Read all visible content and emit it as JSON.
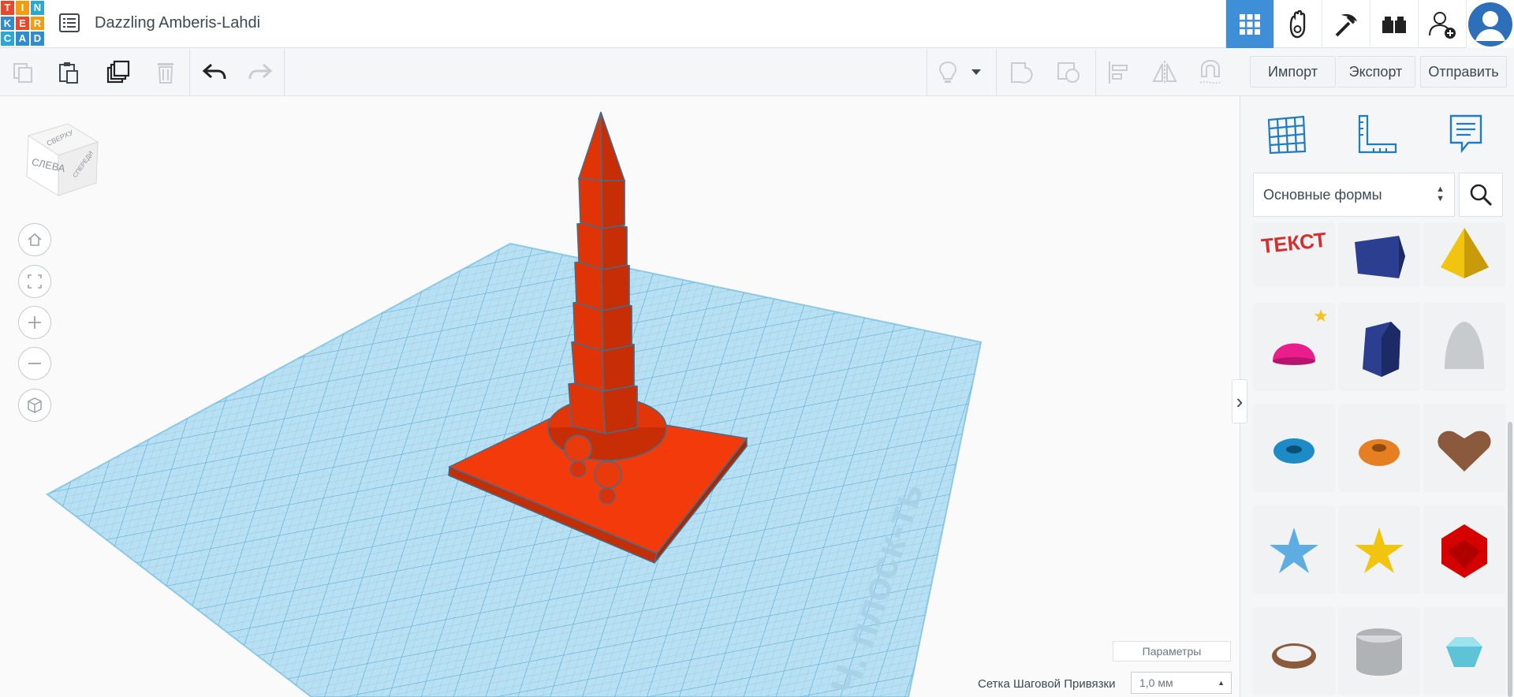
{
  "header": {
    "logo_letters": [
      "T",
      "I",
      "N",
      "K",
      "E",
      "R",
      "C",
      "A",
      "D"
    ],
    "logo_colors": [
      "#e8472b",
      "#f39c12",
      "#2aa7d4",
      "#2e8ccf",
      "#e8472b",
      "#f39c12",
      "#2aa7d4",
      "#2e8ccf",
      "#2e8ccf"
    ],
    "title": "Dazzling Amberis-Lahdi",
    "right_buttons": [
      "grid-view-icon",
      "tinker-hand-icon",
      "pickaxe-icon",
      "bricks-icon",
      "add-user-icon",
      "avatar"
    ]
  },
  "toolbar": {
    "left_tools": [
      "copy-icon",
      "paste-icon",
      "duplicate-icon",
      "delete-icon",
      "undo-icon",
      "redo-icon"
    ],
    "right_tools": [
      "lightbulb-icon",
      "dropdown-arrow-icon",
      "group-icon",
      "hole-icon",
      "align-icon",
      "mirror-icon",
      "magnet-icon"
    ]
  },
  "actions": {
    "import": "Импорт",
    "export": "Экспорт",
    "send": "Отправить"
  },
  "viewcube": {
    "top": "СВЕРХУ",
    "left": "СЛЕВА",
    "front": "СПЕРЕДИ"
  },
  "workplane": {
    "label": "Ч. плоск-ть",
    "params": "Параметры",
    "snap_label": "Сетка Шаговой Привязки",
    "snap_value": "1,0 мм"
  },
  "panel": {
    "category": "Основные формы",
    "tools": [
      "workplane-icon",
      "ruler-icon",
      "notes-icon"
    ],
    "shapes": [
      {
        "name": "text-shape",
        "label": "ТЕКСТ",
        "color": "#d32f2f"
      },
      {
        "name": "box-shape",
        "color": "#2c3e8f"
      },
      {
        "name": "pyramid-shape",
        "color": "#f1c40f"
      },
      {
        "name": "half-sphere-shape",
        "color": "#e91e8c"
      },
      {
        "name": "polygon-shape",
        "color": "#2c3e8f"
      },
      {
        "name": "paraboloid-shape",
        "color": "#c8cbce"
      },
      {
        "name": "torus-shape",
        "color": "#1d8bc8"
      },
      {
        "name": "tube-shape",
        "color": "#e67e22"
      },
      {
        "name": "heart-shape",
        "color": "#8b5a3c"
      },
      {
        "name": "star-shape",
        "color": "#5dade2"
      },
      {
        "name": "star-yellow-shape",
        "color": "#f1c40f"
      },
      {
        "name": "icosahedron-shape",
        "color": "#d50000"
      },
      {
        "name": "ring-shape",
        "color": "#8b5a3c"
      },
      {
        "name": "round-roof-shape",
        "color": "#b0b3b6"
      },
      {
        "name": "gem-shape",
        "color": "#5dc4d8"
      }
    ]
  }
}
